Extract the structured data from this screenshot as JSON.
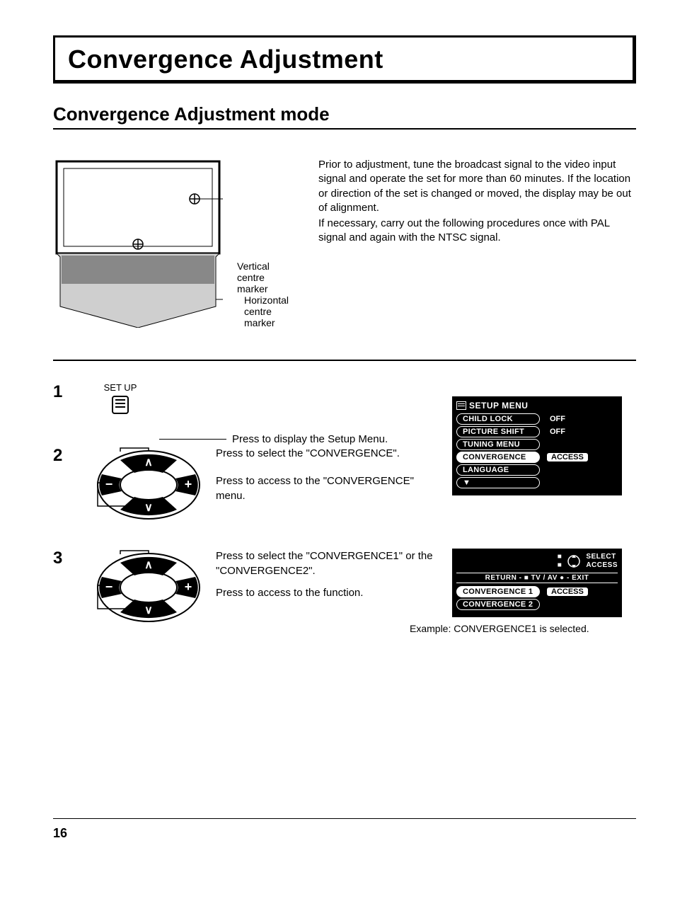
{
  "title": "Convergence Adjustment",
  "subtitle": "Convergence Adjustment mode",
  "intro": {
    "marker_vertical": "Vertical centre marker",
    "marker_horizontal": "Horizontal centre marker",
    "para1": "Prior to adjustment, tune the broadcast signal to the video input signal and operate the set for more than 60 minutes. If the location or direction of the set is changed or moved, the display may be out of alignment.",
    "para2": "If necessary, carry out the following procedures once with PAL signal and again with the NTSC signal."
  },
  "steps": {
    "s1": {
      "num": "1",
      "setup_label": "SET UP",
      "text": "Press to display the Setup Menu."
    },
    "s2": {
      "num": "2",
      "line1": "Press to select the \"CONVERGENCE\".",
      "line2": "Press to  access to the \"CONVERGENCE\" menu."
    },
    "s3": {
      "num": "3",
      "line1": "Press to select the  \"CONVERGENCE1\" or the \"CONVERGENCE2\".",
      "line2": "Press to access to the function.",
      "caption": "Example: CONVERGENCE1 is selected."
    }
  },
  "menu1": {
    "title": "SETUP MENU",
    "items": [
      {
        "label": "CHILD LOCK",
        "value": "OFF"
      },
      {
        "label": "PICTURE SHIFT",
        "value": "OFF"
      },
      {
        "label": "TUNING MENU",
        "value": ""
      },
      {
        "label": "CONVERGENCE",
        "value_box": "ACCESS",
        "selected": true
      },
      {
        "label": "LANGUAGE",
        "value": ""
      }
    ],
    "arrow": "▼"
  },
  "menu2": {
    "header_right1": "SELECT",
    "header_right2": "ACCESS",
    "header_bar": "RETURN - ■  TV / AV ● - EXIT",
    "items": [
      {
        "label": "CONVERGENCE 1",
        "value_box": "ACCESS",
        "selected": true
      },
      {
        "label": "CONVERGENCE 2"
      }
    ]
  },
  "page_number": "16"
}
